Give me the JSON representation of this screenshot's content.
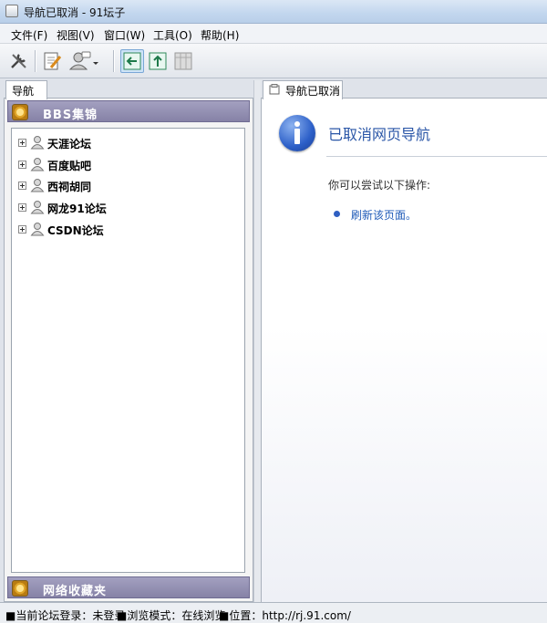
{
  "window": {
    "title": "导航已取消 - 91坛子"
  },
  "menu": [
    "文件(F)",
    "视图(V)",
    "窗口(W)",
    "工具(O)",
    "帮助(H)"
  ],
  "toolbar": {
    "buttons": [
      "settings-icon",
      "edit-icon",
      "user-dropdown-icon",
      "panel-left-icon",
      "panel-top-icon",
      "panel-columns-icon"
    ]
  },
  "left_panel": {
    "tab": "导航",
    "section_bbs": "BBS集锦",
    "forums": [
      "天涯论坛",
      "百度贴吧",
      "西祠胡同",
      "网龙91论坛",
      "CSDN论坛"
    ],
    "section_bookmarks": "网络收藏夹"
  },
  "right_panel": {
    "tab": "导航已取消",
    "heading": "已取消网页导航",
    "subtext": "你可以尝试以下操作:",
    "link": "刷新该页面。"
  },
  "status": {
    "login": "■当前论坛登录：未登录",
    "mode": "■浏览模式：在线浏览",
    "location": "■位置：http://rj.91.com/"
  },
  "colors": {
    "accent": "#2a56a7",
    "section_header": "#8682a6",
    "link": "#1f5bb8"
  }
}
